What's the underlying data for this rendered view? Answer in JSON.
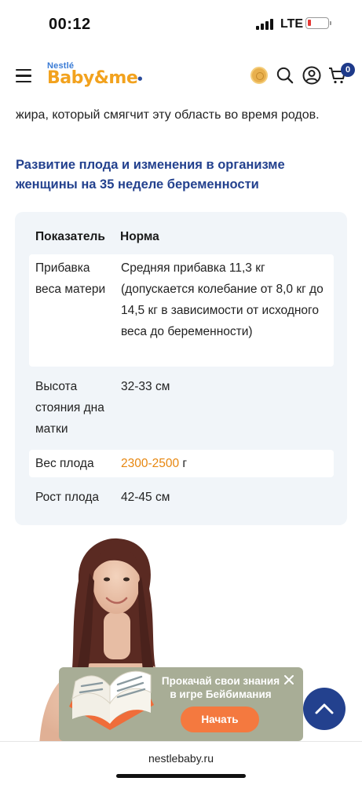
{
  "status_bar": {
    "time": "00:12",
    "network": "LTE"
  },
  "header": {
    "logo_brand": "Nestlé",
    "logo_text_baby": "Baby",
    "logo_text_amp": "&",
    "logo_text_me": "me",
    "cart_count": "0"
  },
  "article": {
    "intro_text": "жира, который смягчит эту область во время родов.",
    "section_title": "Развитие плода и изменения в организме женщины на 35 неделе беременности"
  },
  "table": {
    "headers": [
      "Показатель",
      "Норма"
    ],
    "rows": [
      {
        "label": "Прибавка веса матери",
        "value": "Средняя прибавка 11,3 кг (допускается колебание от 8,0 кг до 14,5 кг в зависимости от исходного веса до беременности)"
      },
      {
        "label": "Высота стояния дна матки",
        "value": "32-33 см"
      },
      {
        "label": "Вес плода",
        "value_accent": "2300-2500",
        "value_suffix": " г"
      },
      {
        "label": "Рост плода",
        "value": "42-45 см"
      }
    ]
  },
  "promo": {
    "title": "Прокачай свои знания в игре Бейбимания",
    "button_label": "Начать"
  },
  "browser": {
    "url": "nestlebaby.ru"
  },
  "colors": {
    "brand_blue": "#23418e",
    "accent_orange": "#e7860f",
    "promo_button": "#f4793f",
    "table_bg": "#f1f5f9"
  }
}
